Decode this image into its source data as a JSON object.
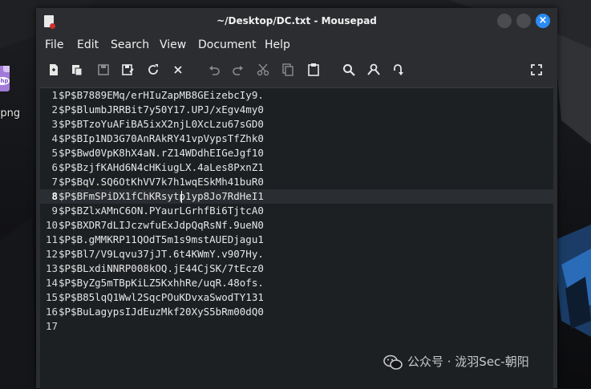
{
  "window": {
    "title": "~/Desktop/DC.txt - Mousepad"
  },
  "desktop": {
    "icon_label": "p.png",
    "icon_badge": "php"
  },
  "menu": [
    "File",
    "Edit",
    "Search",
    "View",
    "Document",
    "Help"
  ],
  "toolbar_icons": [
    "new-document-icon",
    "new-window-icon",
    "save-icon",
    "save-as-icon",
    "reload-icon",
    "close-icon",
    "undo-icon",
    "redo-icon",
    "cut-icon",
    "copy-icon",
    "paste-icon",
    "search-icon",
    "find-replace-icon",
    "go-to-line-icon",
    "fullscreen-icon"
  ],
  "editor": {
    "current_line": 8,
    "lines": [
      {
        "n": "1",
        "text": "$P$B7889EMq/erHIuZapMB8GEizebcIy9."
      },
      {
        "n": "2",
        "text": "$P$BlumbJRRBit7y50Y17.UPJ/xEgv4my0"
      },
      {
        "n": "3",
        "text": "$P$BTzoYuAFiBA5ixX2njL0XcLzu67sGD0"
      },
      {
        "n": "4",
        "text": "$P$BIp1ND3G70AnRAkRY41vpVypsTfZhk0"
      },
      {
        "n": "5",
        "text": "$P$Bwd0VpK8hX4aN.rZ14WDdhEIGeJgf10"
      },
      {
        "n": "6",
        "text": "$P$BzjfKAHd6N4cHKiugLX.4aLes8PxnZ1"
      },
      {
        "n": "7",
        "text": "$P$BqV.SQ6OtKhVV7k7h1wqESkMh41buR0"
      },
      {
        "n": "8",
        "text": "$P$BFmSPiDX1fChKRsytp1yp8Jo7RdHeI1"
      },
      {
        "n": "9",
        "text": "$P$BZlxAMnC6ON.PYaurLGrhfBi6TjtcA0"
      },
      {
        "n": "10",
        "text": "$P$BXDR7dLIJczwfuExJdpQqRsNf.9ueN0"
      },
      {
        "n": "11",
        "text": "$P$B.gMMKRP11QOdT5m1s9mstAUEDjagu1"
      },
      {
        "n": "12",
        "text": "$P$Bl7/V9Lqvu37jJT.6t4KWmY.v907Hy."
      },
      {
        "n": "13",
        "text": "$P$BLxdiNNRP008kOQ.jE44CjSK/7tEcz0"
      },
      {
        "n": "14",
        "text": "$P$ByZg5mTBpKiLZ5KxhhRe/uqR.48ofs."
      },
      {
        "n": "15",
        "text": "$P$B85lqQ1Wwl2SqcPOuKDvxaSwodTY131"
      },
      {
        "n": "16",
        "text": "$P$BuLagypsIJdEuzMkf20XyS5bRm00dQ0"
      },
      {
        "n": "17",
        "text": ""
      }
    ]
  },
  "watermark": {
    "text": "公众号 · 泷羽Sec-朝阳"
  },
  "colors": {
    "accent": "#2a8bf2",
    "editor_bg": "#1d2023",
    "window_bg": "#2b2d30"
  }
}
